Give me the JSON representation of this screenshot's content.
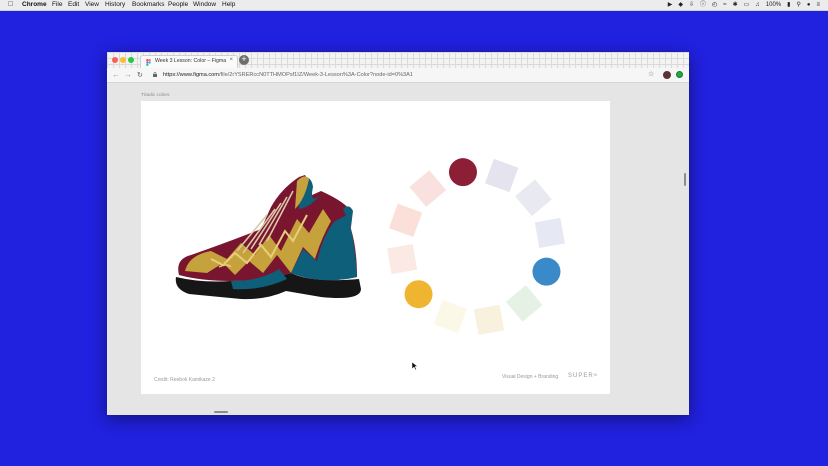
{
  "menubar": {
    "app": "Chrome",
    "items": [
      "File",
      "Edit",
      "View",
      "History",
      "Bookmarks",
      "People",
      "Window",
      "Help"
    ],
    "battery": "100%"
  },
  "browser": {
    "tab_title": "Week 3 Lesson: Color – Figma",
    "tab_close": "×",
    "new_tab": "+",
    "url_host": "https://www.figma.com",
    "url_path": "/file/2rYSRERccN0TTHMOPsf1IZ/Week-3-Lesson%3A-Color?node-id=0%3A1"
  },
  "canvas": {
    "frame_label": "Triadic colors",
    "credit": "Credit: Reebok Kamikaze 2",
    "course": "Visual Design + Branding",
    "brand": "SUPER",
    "brand_sup": "HI"
  },
  "colors": {
    "background": "#2121e0",
    "triad_red": "#8c1f35",
    "triad_blue": "#3a8ac9",
    "triad_yellow": "#f0b530"
  },
  "color_wheel": [
    {
      "type": "circle",
      "color": "#8c1f35"
    },
    {
      "type": "square",
      "color": "#e4e3ee"
    },
    {
      "type": "square",
      "color": "#e9e9f2"
    },
    {
      "type": "square",
      "color": "#e6e9f4"
    },
    {
      "type": "circle",
      "color": "#3a8ac9"
    },
    {
      "type": "square",
      "color": "#e6f1e5"
    },
    {
      "type": "square",
      "color": "#f8f1de"
    },
    {
      "type": "square",
      "color": "#fcf8e8"
    },
    {
      "type": "circle",
      "color": "#f0b530"
    },
    {
      "type": "square",
      "color": "#fbeae3"
    },
    {
      "type": "square",
      "color": "#fae0d8"
    },
    {
      "type": "square",
      "color": "#f8e1de"
    }
  ]
}
